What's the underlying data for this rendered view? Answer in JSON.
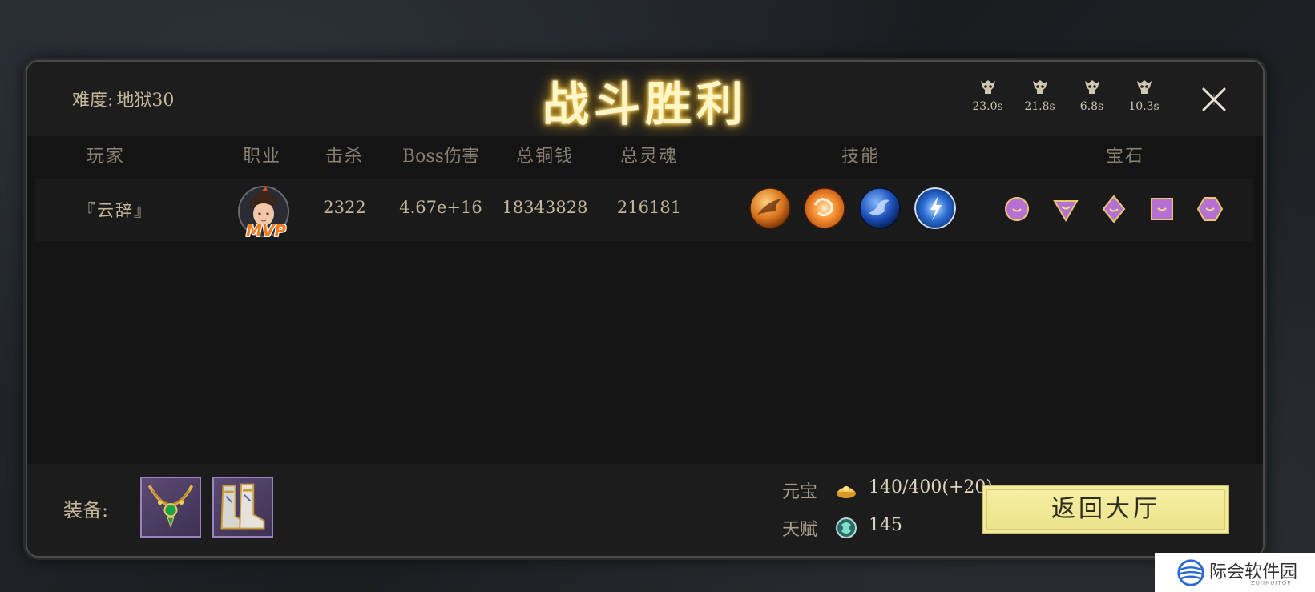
{
  "header": {
    "difficulty_label": "难度:",
    "difficulty_value": "地狱30",
    "title": "战斗胜利",
    "timers": [
      "23.0s",
      "21.8s",
      "6.8s",
      "10.3s"
    ],
    "close_icon": "close-icon"
  },
  "columns": [
    "玩家",
    "职业",
    "击杀",
    "Boss伤害",
    "总铜钱",
    "总灵魂",
    "技能",
    "宝石"
  ],
  "players": [
    {
      "name": "『云辞』",
      "badge": "MVP",
      "kills": "2322",
      "boss_damage": "4.67e+16",
      "total_copper": "18343828",
      "total_soul": "216181",
      "skills": [
        "fire-slash-skill-icon",
        "fire-orb-skill-icon",
        "water-wave-skill-icon",
        "lightning-orb-skill-icon"
      ],
      "gems": [
        "circle-gem-icon",
        "triangle-gem-icon",
        "diamond-gem-icon",
        "square-gem-icon",
        "hexagon-gem-icon"
      ]
    }
  ],
  "footer": {
    "equipment_label": "装备:",
    "equipment": [
      "necklace-icon",
      "boots-icon"
    ],
    "yuanbao_label": "元宝",
    "yuanbao_value": "140/400(+20)",
    "talent_label": "天赋",
    "talent_value": "145",
    "return_button": "返回大厅"
  },
  "watermark": {
    "text": "际会软件园",
    "sub": "ZUJIHUITOP"
  },
  "colors": {
    "title_glow": "#f4c542",
    "gem_purple": "#b66fd3",
    "button_yellow": "#f6efa4"
  }
}
